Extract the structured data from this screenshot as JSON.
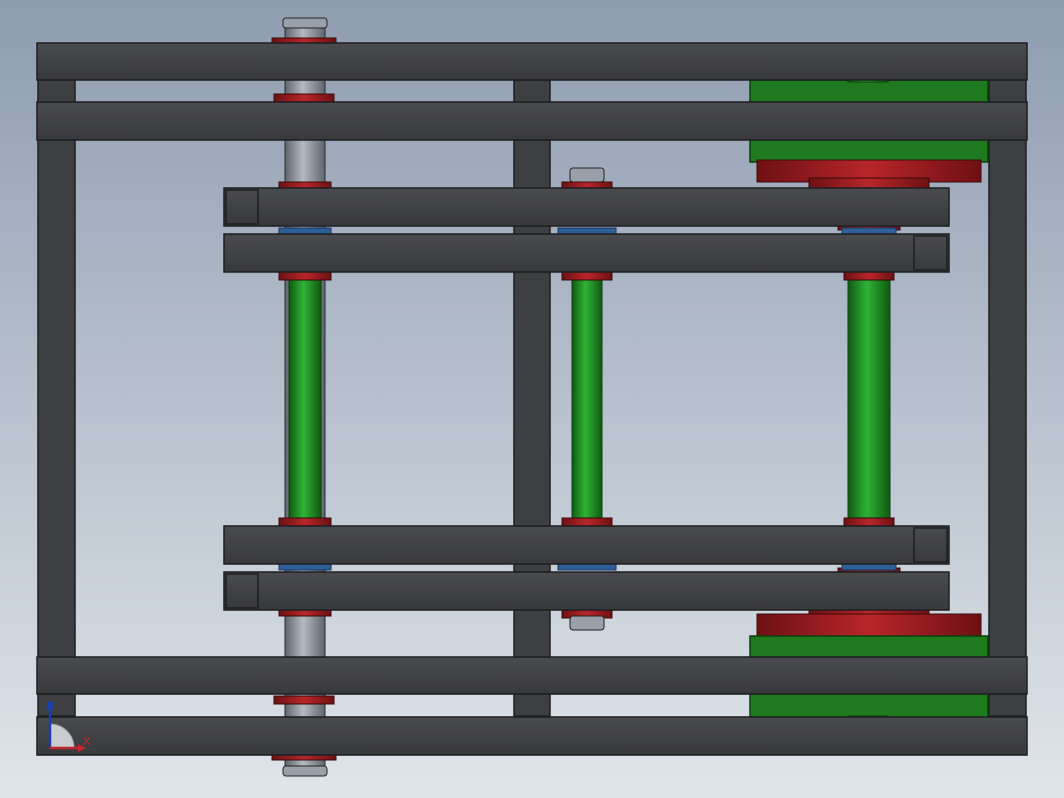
{
  "colors": {
    "background_top": "#8f9db1",
    "background_bottom": "#dfe4e9",
    "frame_steel": "#3e3f42",
    "frame_edge": "#1d1e20",
    "roller_green": "#1a8f1f",
    "bearing_red": "#9a1b1e",
    "shaft_grey": "#8b909a",
    "spacer_blue": "#2d5f9a",
    "gear_green": "#1f7a1f",
    "axis_x": "#c0262b",
    "axis_y": "#2a8a2a",
    "axis_z": "#1b3fb3"
  },
  "triad": {
    "z_label": "Z",
    "x_label": "X"
  }
}
